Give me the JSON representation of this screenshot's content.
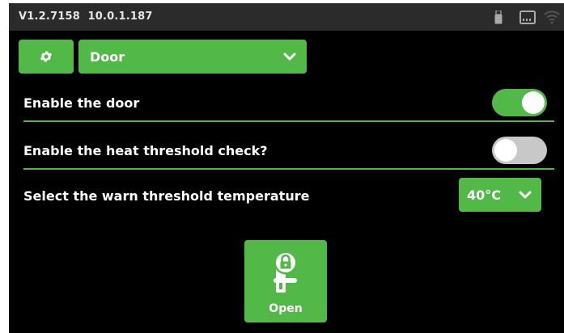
{
  "status_bar": {
    "version": "V1.2.7158",
    "ip": "10.0.1.187",
    "icons": [
      "usb-icon",
      "sd-card-icon",
      "wifi-icon"
    ]
  },
  "section": {
    "settings_icon": "gear-icon",
    "selected": "Door"
  },
  "settings": {
    "enable_door": {
      "label": "Enable the door",
      "enabled": true
    },
    "heat_check": {
      "label": "Enable the heat threshold check?",
      "enabled": false
    },
    "warn_temp": {
      "label": "Select the warn threshold temperature",
      "value": "40°C"
    }
  },
  "action": {
    "label": "Open",
    "icon": "door-lock-icon"
  },
  "colors": {
    "accent": "#52b848",
    "background": "#000000",
    "status_bar": "#2b2b2b",
    "toggle_off": "#c8c8c8"
  }
}
